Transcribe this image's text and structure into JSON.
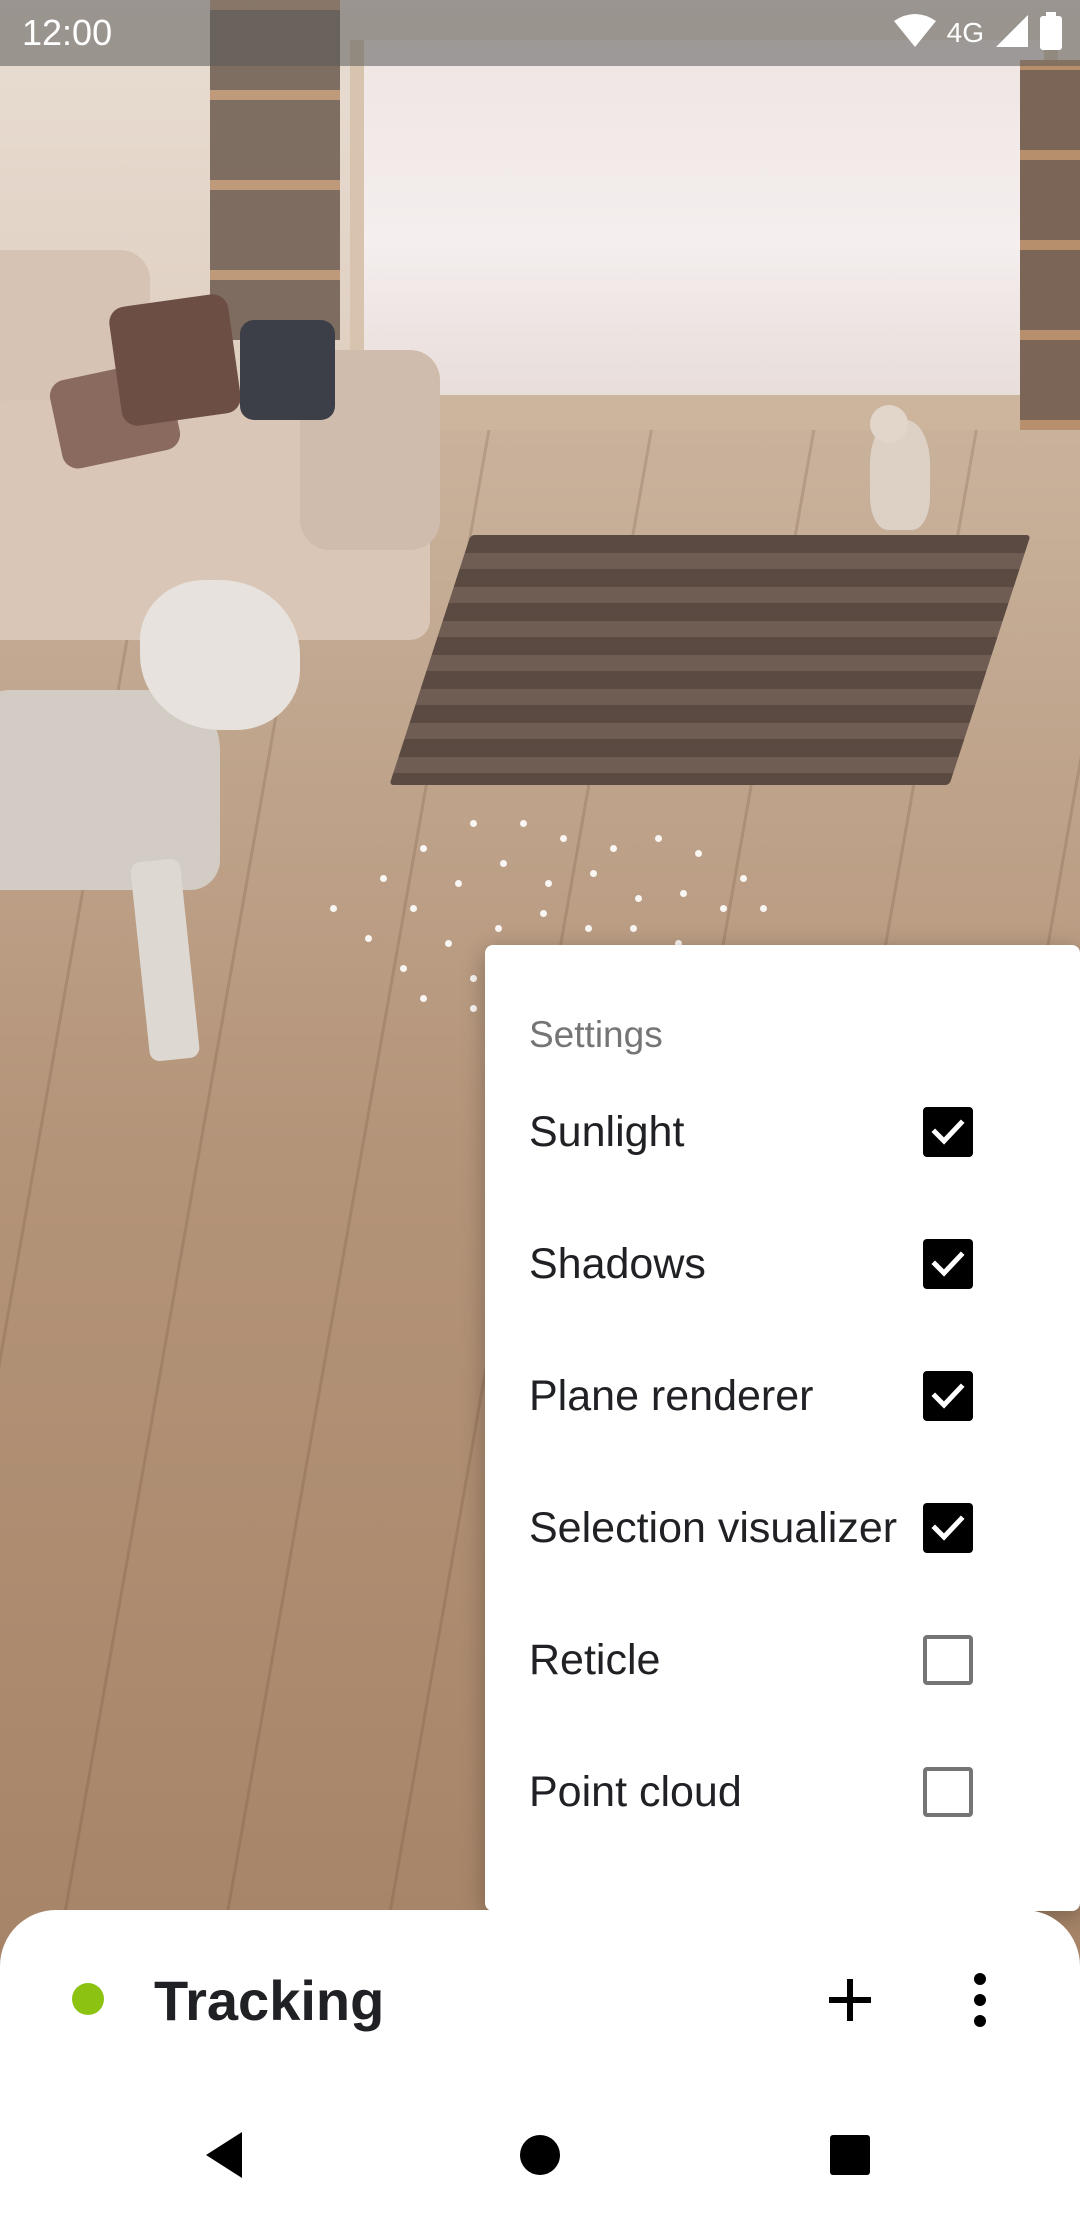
{
  "status_bar": {
    "time": "12:00",
    "network": "4G",
    "icons": [
      "wifi-icon",
      "cell-signal-icon",
      "battery-icon"
    ]
  },
  "settings_menu": {
    "title": "Settings",
    "items": [
      {
        "label": "Sunlight",
        "checked": true
      },
      {
        "label": "Shadows",
        "checked": true
      },
      {
        "label": "Plane renderer",
        "checked": true
      },
      {
        "label": "Selection visualizer",
        "checked": true
      },
      {
        "label": "Reticle",
        "checked": false
      },
      {
        "label": "Point cloud",
        "checked": false
      }
    ]
  },
  "bottom_sheet": {
    "status_label": "Tracking",
    "status_color": "#8cc313",
    "actions": [
      "add-icon",
      "more-vert-icon"
    ]
  },
  "nav_bar": {
    "buttons": [
      "back-icon",
      "home-icon",
      "recents-icon"
    ]
  }
}
